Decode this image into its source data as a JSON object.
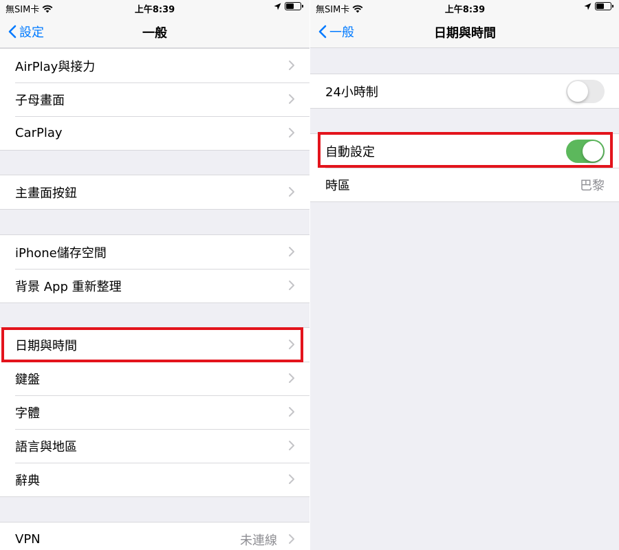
{
  "status_bar": {
    "carrier": "無SIM卡",
    "time": "上午8:39",
    "battery_level": 0.6
  },
  "left": {
    "nav": {
      "back_label": "設定",
      "title": "一般"
    },
    "groups": [
      [
        "AirPlay與接力",
        "子母畫面",
        "CarPlay"
      ],
      [
        "主畫面按鈕"
      ],
      [
        "iPhone儲存空間",
        "背景 App 重新整理"
      ],
      [
        "日期與時間",
        "鍵盤",
        "字體",
        "語言與地區",
        "辭典"
      ],
      [
        "VPN"
      ]
    ],
    "vpn_value": "未連線"
  },
  "right": {
    "nav": {
      "back_label": "一般",
      "title": "日期與時間"
    },
    "rows": {
      "clock_24": {
        "label": "24小時制",
        "enabled": false
      },
      "auto_set": {
        "label": "自動設定",
        "enabled": true
      },
      "time_zone": {
        "label": "時區",
        "value": "巴黎"
      }
    }
  },
  "colors": {
    "accent": "#007aff",
    "toggle_on": "#5cb85c",
    "highlight": "#e3141c"
  },
  "icons": [
    "no-sim-icon",
    "wifi-icon",
    "location-arrow-icon",
    "battery-icon",
    "back-chevron-icon",
    "chevron-right-icon"
  ]
}
